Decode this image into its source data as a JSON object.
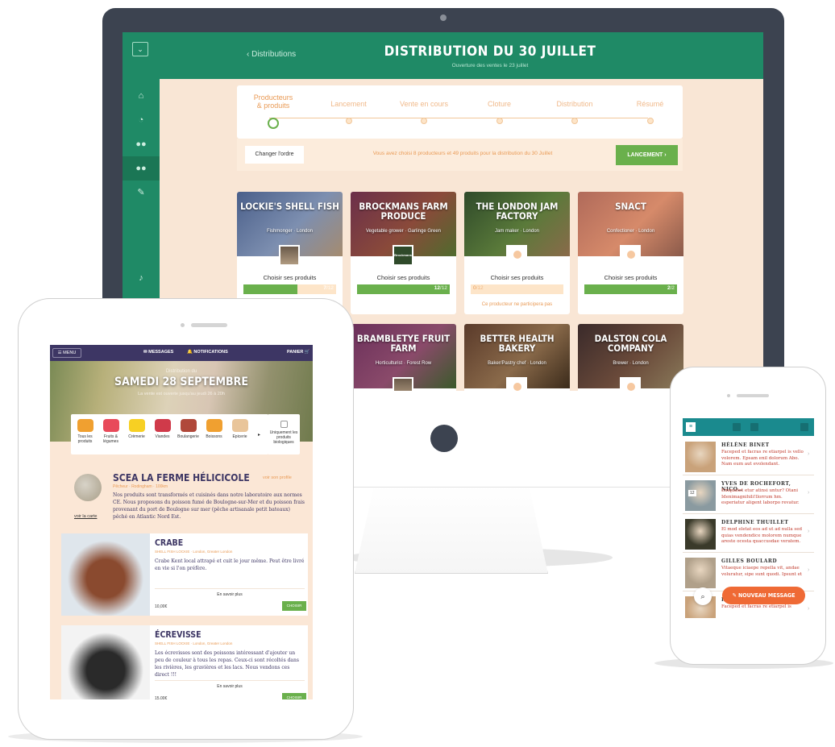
{
  "desktop": {
    "sidebar": {
      "menu_icon": "⌄",
      "icons": [
        "home-icon",
        "chat-icon",
        "group-icon",
        "users-icon",
        "pencil-icon",
        "bell-icon"
      ]
    },
    "header": {
      "back_label": "‹ Distributions",
      "title": "DISTRIBUTION DU 30 JUILLET",
      "subtitle": "Ouverture des ventes le 23 juillet"
    },
    "steps": [
      {
        "label": "Producteurs\n& produits",
        "active": true
      },
      {
        "label": "Lancement",
        "active": false
      },
      {
        "label": "Vente en cours",
        "active": false
      },
      {
        "label": "Cloture",
        "active": false
      },
      {
        "label": "Distribution",
        "active": false
      },
      {
        "label": "Résumé",
        "active": false
      }
    ],
    "action_bar": {
      "order_button": "Changer l'ordre",
      "summary": "Vous avez choisi 8 producteurs et 49 produits pour la distribution du 30 Juillet",
      "launch_button": "LANCEMENT ›"
    },
    "producers_row1": [
      {
        "name": "LOCKIE'S SHELL FISH",
        "role": "Fishmonger · London",
        "choose": "Choisir ses produits",
        "selected": "7",
        "total": "/12",
        "fraction": 0.58,
        "note": "",
        "avatar": "photo",
        "colors": [
          "#4a5f8a",
          "#7d8fb0",
          "#a58b6f"
        ]
      },
      {
        "name": "BROCKMANS FARM PRODUCE",
        "role": "Vegetable grower · Garlinge Green",
        "choose": "Choisir ses produits",
        "selected": "12",
        "total": "/12",
        "fraction": 1.0,
        "note": "",
        "avatar": "logo",
        "logo_text": "Brockmans",
        "colors": [
          "#6b2f4a",
          "#8a4a3a",
          "#4f6b2d"
        ]
      },
      {
        "name": "THE LONDON JAM FACTORY",
        "role": "Jam maker · London",
        "choose": "Choisir ses produits",
        "selected": "0",
        "total": "/12",
        "fraction": 0.0,
        "note": "Ce producteur ne participera pas",
        "avatar": "empty",
        "colors": [
          "#2f4a2a",
          "#5a7a3a",
          "#8a6a4a"
        ]
      },
      {
        "name": "SNACT",
        "role": "Confectioner · London",
        "choose": "Choisir ses produits",
        "selected": "2",
        "total": "/2",
        "fraction": 1.0,
        "note": "",
        "avatar": "empty",
        "colors": [
          "#b06a5a",
          "#d68a6a",
          "#8a5a4a"
        ]
      }
    ],
    "producers_row2": [
      {
        "name": "BRAMBLETYE FRUIT FARM",
        "role": "Horticulturist · Forest Row",
        "colors": [
          "#6a2f5a",
          "#8a4a6a",
          "#3a5a2a"
        ],
        "avatar": "photo"
      },
      {
        "name": "BETTER HEALTH BAKERY",
        "role": "Baker/Pastry chef · London",
        "colors": [
          "#5a3a2a",
          "#8a6a4a",
          "#3a2a1a"
        ],
        "avatar": "empty"
      },
      {
        "name": "DALSTON COLA COMPANY",
        "role": "Brewer · London",
        "colors": [
          "#3a2a2a",
          "#6a4a3a",
          "#8a7a5a"
        ],
        "avatar": "empty"
      }
    ]
  },
  "tablet": {
    "nav": {
      "menu": "☰ MENU",
      "messages": "✉ MESSAGES",
      "notifications": "🔔 NOTIFICATIONS",
      "cart": "PANIER 🛒"
    },
    "hero": {
      "subtitle": "Distribution du",
      "title": "SAMEDI 28 SEPTEMBRE",
      "info": "La vente est ouverte jusqu'au jeudi 26 à 20h"
    },
    "categories": [
      {
        "label": "Tous les produits",
        "color": "#f0a030"
      },
      {
        "label": "Fruits & légumes",
        "color": "#e84a5a"
      },
      {
        "label": "Crèmerie",
        "color": "#f7d023"
      },
      {
        "label": "Viandes",
        "color": "#d03a4a"
      },
      {
        "label": "Boulangerie",
        "color": "#b0483a"
      },
      {
        "label": "Boissons",
        "color": "#f0a030"
      },
      {
        "label": "Epicerie",
        "color": "#e9c59a"
      }
    ],
    "bio_filter": "Uniquement les produits biologiques",
    "producer": {
      "name": "SCEA LA FERME HÉLICICOLE",
      "location": "Pêcheur · Rodingham · 100km",
      "profile_link": "voir son profile",
      "map_link": "voir la carte",
      "description": "Nos produits sont transformés et cuisinés dans notre laboratoire aux normes CE. Nous proposons du poisson fumé de Boulogne-sur-Mer et du poisson frais provenant du port de Boulogne sur mer (pêche artisanale petit bateaux) pêché en Atlantic Nord Est."
    },
    "products": [
      {
        "name": "CRABE",
        "meta": "SHELL FISH LOCKIE · London, Greater London",
        "description": "Crabe Kent local attrapé et cuit le jour même. Peut être livré en vie si l'on préfère.",
        "more": "En savoir plus",
        "price": "10,00€",
        "button": "CHOISIR",
        "img_colors": [
          "#dfe6ec",
          "#8a4a2f"
        ]
      },
      {
        "name": "ÉCREVISSE",
        "meta": "SHELL FISH LOCKIE · London, Greater London",
        "description": "Les écrevisses sont des poissons intéressant d'ajouter un peu de couleur à tous les repas. Ceux-ci sont récoltés dans les rivières, les gravières et les lacs. Nous vendons ces direct !!!",
        "more": "En savoir plus",
        "price": "15,00€",
        "button": "CHOISIR",
        "img_colors": [
          "#f3f3f3",
          "#2a2a2a"
        ]
      }
    ]
  },
  "phone": {
    "nav_icons": [
      "menu-icon",
      "calendar-icon",
      "chat-icon",
      "grid-icon"
    ],
    "messages": [
      {
        "name": "HÉLÈNE BINET",
        "text": "Faceped et facras re etiarpel is vello volorem. Epsam enil dolorum Abo. Nam eum aut evolendant.",
        "avatar_color": "#c9a27a"
      },
      {
        "name": "YVES DE ROCHEFORT, NICO…",
        "text": "Emquatet etur atinsi untur? Otani Idenimagnihili!llorrum hm. esperiatur aligent laborpo revatur.",
        "avatar_color": "#8a9aa0",
        "badge": "12"
      },
      {
        "name": "DELPHINE THUILLET",
        "text": "El mod eletat eos ad ut ad nulla sed quias vendendice molorem numque areste ocesta quaccusdae veratem.",
        "avatar_color": "#3a3a2a"
      },
      {
        "name": "GILLES BOULARD",
        "text": "Vitaeque iciaepe repella vit, andae voluratur, sipe sunt quodi. Ipsunt et",
        "avatar_color": "#b0a08a"
      },
      {
        "name": "HÉLÈNE BINET",
        "text": "Faceped et facras re etiarpel is",
        "avatar_color": "#c9a27a"
      }
    ],
    "new_message_button": "✎ NOUVEAU MESSAGE",
    "search_icon": "⌕"
  }
}
